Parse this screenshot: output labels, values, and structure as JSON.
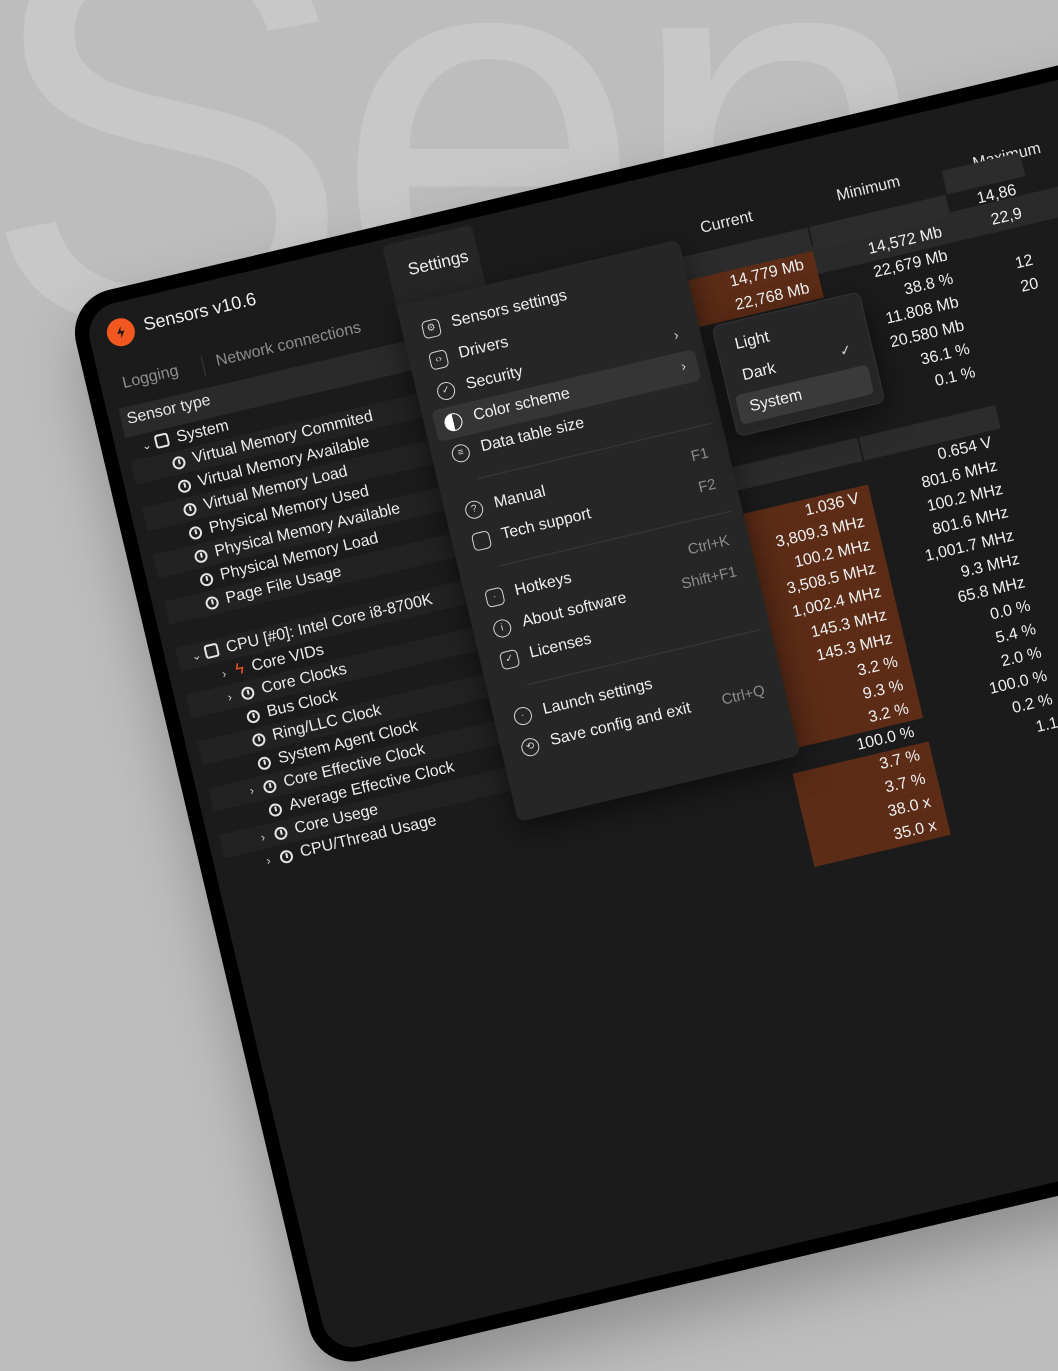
{
  "background_word": "Sen",
  "app": {
    "title": "Sensors v10.6",
    "logo_icon": "bolt-icon",
    "accent": "#f2571f"
  },
  "tabs": [
    {
      "label": "Logging"
    },
    {
      "label": "Network connections"
    },
    {
      "label": "Settings"
    }
  ],
  "table": {
    "sensor_type_label": "Sensor type",
    "columns": [
      "Current",
      "Minimum",
      "Maximum"
    ]
  },
  "tree": [
    {
      "label": "System",
      "icon": "chip-icon",
      "expanded": true,
      "level": 0
    },
    {
      "label": "Virtual Memory Commited",
      "icon": "gauge-icon",
      "level": 1
    },
    {
      "label": "Virtual Memory Available",
      "icon": "gauge-icon",
      "level": 1
    },
    {
      "label": "Virtual Memory Load",
      "icon": "gauge-icon",
      "level": 1
    },
    {
      "label": "Physical Memory Used",
      "icon": "gauge-icon",
      "level": 1
    },
    {
      "label": "Physical Memory Available",
      "icon": "gauge-icon",
      "level": 1
    },
    {
      "label": "Physical Memory Load",
      "icon": "gauge-icon",
      "level": 1
    },
    {
      "label": "Page File Usage",
      "icon": "gauge-icon",
      "level": 1
    },
    {
      "label": "",
      "level": 1
    },
    {
      "label": "CPU [#0]: Intel Core i8-8700K",
      "icon": "chip-icon",
      "expanded": true,
      "level": 0
    },
    {
      "label": "Core VIDs",
      "icon": "bolt-icon",
      "collapsed": true,
      "level": 1
    },
    {
      "label": "Core Clocks",
      "icon": "gauge-icon",
      "collapsed": true,
      "level": 1
    },
    {
      "label": "Bus Clock",
      "icon": "gauge-icon",
      "level": 1
    },
    {
      "label": "Ring/LLC Clock",
      "icon": "gauge-icon",
      "level": 1
    },
    {
      "label": "System Agent Clock",
      "icon": "gauge-icon",
      "level": 1
    },
    {
      "label": "Core Effective Clock",
      "icon": "gauge-icon",
      "collapsed": true,
      "level": 1
    },
    {
      "label": "Average Effective Clock",
      "icon": "gauge-icon",
      "level": 1
    },
    {
      "label": "Core Usege",
      "icon": "gauge-icon",
      "collapsed": true,
      "level": 1
    },
    {
      "label": "CPU/Thread Usage",
      "icon": "gauge-icon",
      "level": 1
    }
  ],
  "values": {
    "current": [
      "",
      "14,779 Mb",
      "22,768 Mb",
      "",
      "",
      "",
      "",
      "0.1 %",
      "",
      "",
      "",
      "1.036 V",
      "3,809.3 MHz",
      "100.2 MHz",
      "3,508.5 MHz",
      "1,002.4 MHz",
      "145.3 MHz",
      "145.3 MHz",
      "3.2 %",
      "9.3 %",
      "3.2 %",
      "100.0 %",
      "3.7 %",
      "3.7 %",
      "38.0 x",
      "35.0 x"
    ],
    "minimum": [
      "",
      "14,572 Mb",
      "22,679 Mb",
      "38.8 %",
      "11.808 Mb",
      "20.580 Mb",
      "36.1 %",
      "0.1 %",
      "",
      "",
      "0.654 V",
      "801.6 MHz",
      "100.2 MHz",
      "801.6 MHz",
      "1,001.7 MHz",
      "9.3 MHz",
      "65.8 MHz",
      "0.0 %",
      "5.4 %",
      "2.0 %",
      "100.0 %",
      "0.2 %",
      "1.1"
    ],
    "maximum": [
      "14,86",
      "22,9",
      "",
      "12",
      "20",
      "",
      "",
      "",
      "",
      ""
    ]
  },
  "settings_menu": {
    "items": [
      {
        "label": "Sensors settings",
        "icon": "hexagon-gear-icon"
      },
      {
        "label": "Drivers",
        "icon": "code-icon"
      },
      {
        "label": "Security",
        "icon": "shield-check-icon",
        "submenu": true
      },
      {
        "label": "Color scheme",
        "icon": "contrast-icon",
        "submenu": true,
        "active": true
      },
      {
        "label": "Data table size",
        "icon": "table-icon"
      },
      {
        "label": "Manual",
        "icon": "question-icon",
        "shortcut": "F1"
      },
      {
        "label": "Tech support",
        "icon": "chat-icon",
        "shortcut": "F2"
      },
      {
        "label": "Hotkeys",
        "icon": "keyboard-icon",
        "shortcut": "Ctrl+K"
      },
      {
        "label": "About software",
        "icon": "info-icon",
        "shortcut": "Shift+F1"
      },
      {
        "label": "Licenses",
        "icon": "license-icon"
      },
      {
        "label": "Launch settings",
        "icon": "clock-icon"
      },
      {
        "label": "Save config and exit",
        "icon": "save-icon",
        "shortcut": "Ctrl+Q"
      }
    ]
  },
  "color_scheme_submenu": {
    "items": [
      {
        "label": "Light"
      },
      {
        "label": "Dark",
        "checked": true
      },
      {
        "label": "System",
        "hover": true
      }
    ]
  }
}
